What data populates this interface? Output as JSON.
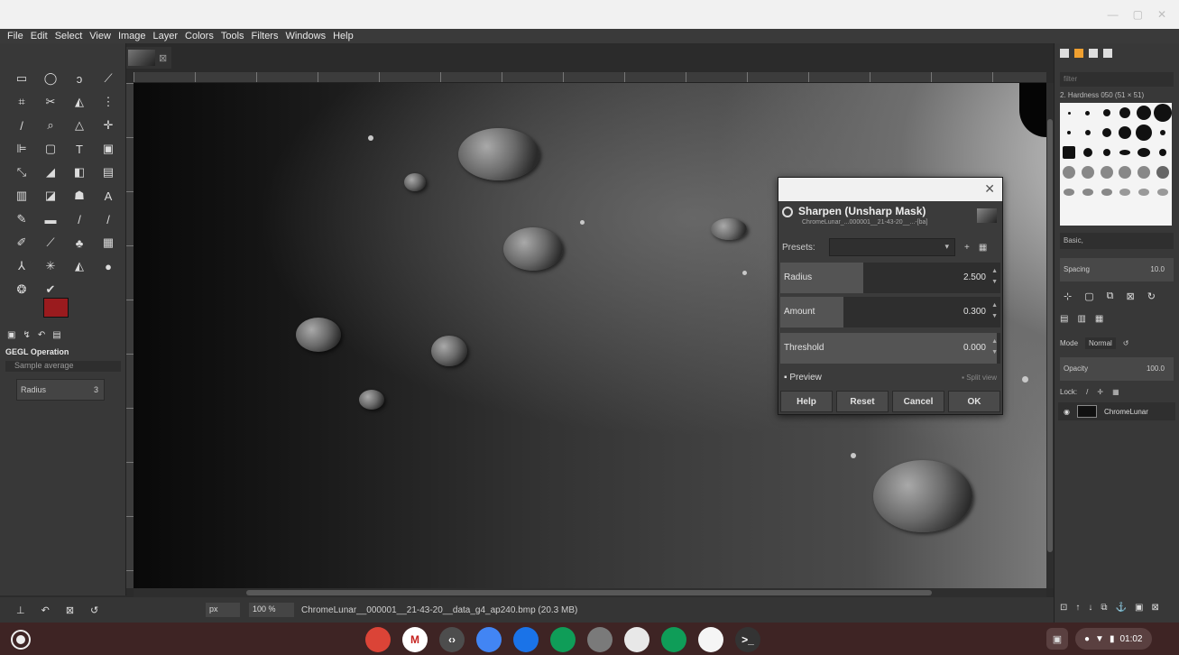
{
  "menubar": [
    "File",
    "Edit",
    "Select",
    "View",
    "Image",
    "Layer",
    "Colors",
    "Tools",
    "Filters",
    "Windows",
    "Help"
  ],
  "toolbox": {
    "gegl_title": "GEGL Operation",
    "sampling_label": "Sample average",
    "radius_label": "Radius",
    "radius_value": "3"
  },
  "dialog": {
    "title": "Sharpen (Unsharp Mask)",
    "subtitle": "ChromeLunar_...000001__21-43-20__...-[ba]",
    "presets_label": "Presets:",
    "params": [
      {
        "label": "Radius",
        "value": "2.500"
      },
      {
        "label": "Amount",
        "value": "0.300"
      },
      {
        "label": "Threshold",
        "value": "0.000"
      }
    ],
    "preview_label": "Preview",
    "split_label": "Split view",
    "buttons": {
      "help": "Help",
      "reset": "Reset",
      "cancel": "Cancel",
      "ok": "OK"
    },
    "close_glyph": "✕"
  },
  "statusbar": {
    "unit": "px",
    "zoom": "100 %",
    "text": "ChromeLunar__000001__21-43-20__data_g4_ap240.bmp (20.3 MB)"
  },
  "dock": {
    "filter_placeholder": "filter",
    "brush_name": "2. Hardness 050 (51 × 51)",
    "preset": "Basic,",
    "spacing_label": "Spacing",
    "spacing_value": "10.0",
    "mode_label": "Mode",
    "mode_value": "Normal",
    "opacity_label": "Opacity",
    "opacity_value": "100.0",
    "lock_label": "Lock:",
    "layer_name": "ChromeLunar"
  },
  "shelf": {
    "apps": [
      {
        "name": "chrome",
        "color": "#db4437",
        "glyph": ""
      },
      {
        "name": "gmail",
        "color": "#ffffff",
        "glyph": "M"
      },
      {
        "name": "terminal-dev",
        "color": "#4d4d4d",
        "glyph": "‹›"
      },
      {
        "name": "docs",
        "color": "#4285f4",
        "glyph": ""
      },
      {
        "name": "files",
        "color": "#1a73e8",
        "glyph": ""
      },
      {
        "name": "drive",
        "color": "#0f9d58",
        "glyph": ""
      },
      {
        "name": "gimp",
        "color": "#7a7a7a",
        "glyph": ""
      },
      {
        "name": "web-store",
        "color": "#e8e8e8",
        "glyph": ""
      },
      {
        "name": "green-app",
        "color": "#0f9d58",
        "glyph": ""
      },
      {
        "name": "camera",
        "color": "#f5f5f5",
        "glyph": ""
      },
      {
        "name": "linux-terminal",
        "color": "#333333",
        "glyph": ">_"
      }
    ],
    "time": "01:02"
  },
  "colors": {
    "fg": "#9a1b1e",
    "bg": "#ffffff",
    "preset_highlight": "#f0a030"
  }
}
